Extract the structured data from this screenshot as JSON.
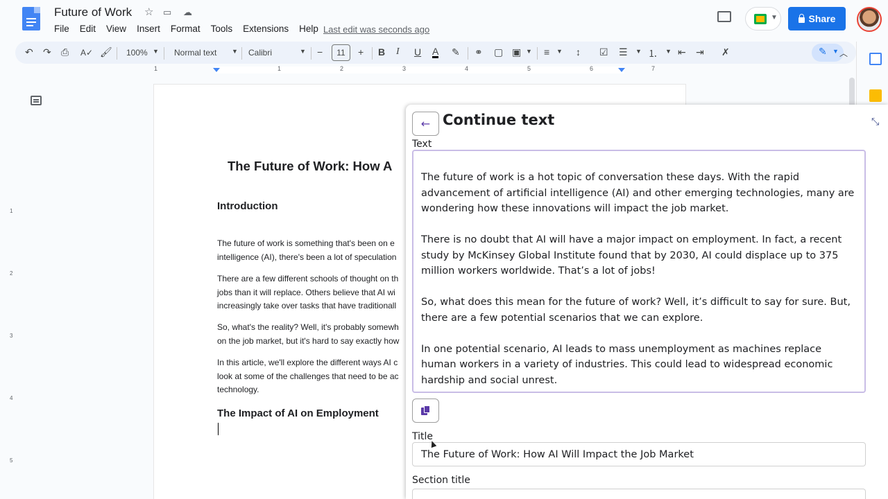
{
  "app": {
    "doc_title": "Future of Work",
    "menu": [
      "File",
      "Edit",
      "View",
      "Insert",
      "Format",
      "Tools",
      "Extensions",
      "Help"
    ],
    "last_edit": "Last edit was seconds ago",
    "share_label": "Share"
  },
  "toolbar": {
    "zoom": "100%",
    "style": "Normal text",
    "font": "Calibri",
    "font_size": "11"
  },
  "ruler": [
    "1",
    "1",
    "2",
    "3",
    "4",
    "5",
    "6",
    "7"
  ],
  "vruler": [
    "1",
    "2",
    "3",
    "4",
    "5"
  ],
  "document": {
    "title": "The Future of Work: How A",
    "intro_heading": "Introduction",
    "paragraphs": [
      "The future of work is something that's been on e\nintelligence (AI), there's been a lot of speculation",
      "There are a few different schools of thought on th\njobs than it will replace. Others believe that AI wi\nincreasingly take over tasks that have traditionall",
      "So, what's the reality? Well, it's probably somewh\non the job market, but it's hard to say exactly how",
      "In this article, we'll explore the different ways AI c\nlook at some of the challenges that need to be ac\ntechnology."
    ],
    "section_heading": "The Impact of AI on Employment"
  },
  "panel": {
    "title": "Continue text",
    "text_label": "Text",
    "text_paragraphs": [
      "The future of work is a hot topic of conversation these days. With the rapid advancement of artificial intelligence (AI) and other emerging technologies, many are wondering how these innovations will impact the job market.",
      "There is no doubt that AI will have a major impact on employment. In fact, a recent study by McKinsey Global Institute found that by 2030, AI could displace up to 375 million workers worldwide. That’s a lot of jobs!",
      "So, what does this mean for the future of work? Well, it’s difficult to say for sure. But, there are a few potential scenarios that we can explore.",
      "In one potential scenario, AI leads to mass unemployment as machines replace human workers in a variety of industries. This could lead to widespread economic hardship and social unrest."
    ],
    "title_label": "Title",
    "title_value": "The Future of Work: How AI Will Impact the Job Market",
    "section_label": "Section title"
  },
  "colors": {
    "accent": "#1a73e8",
    "panel_accent": "#5b3aa8",
    "textarea_border": "#c9bde6"
  }
}
